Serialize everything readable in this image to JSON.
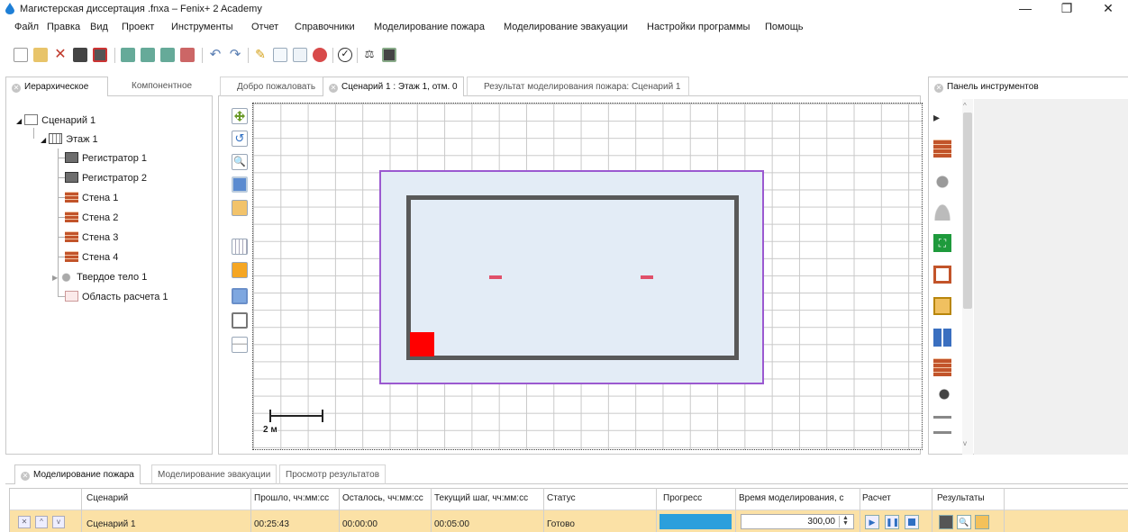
{
  "window": {
    "title": "Магистерская диссертация .fnxa – Fenix+ 2 Academy",
    "minimize": "—",
    "restore": "❐",
    "close": "✕"
  },
  "menu": [
    "Файл",
    "Правка",
    "Вид",
    "Проект",
    "Инструменты",
    "Отчет",
    "Справочники",
    "Моделирование пожара",
    "Моделирование эвакуации",
    "Настройки программы",
    "Помощь"
  ],
  "left_panel": {
    "tabs": [
      "Иерархическое",
      "Компонентное"
    ],
    "tree": {
      "scenario": "Сценарий 1",
      "floor": "Этаж 1",
      "items": [
        "Регистратор 1",
        "Регистратор 2",
        "Стена 1",
        "Стена 2",
        "Стена 3",
        "Стена 4",
        "Твердое тело 1",
        "Область расчета 1"
      ]
    }
  },
  "editor": {
    "tabs": [
      "Добро пожаловать",
      "Сценарий 1 : Этаж 1, отм. 0",
      "Результат моделирования пожара: Сценарий 1"
    ],
    "scale_label": "2 м"
  },
  "tools_panel": {
    "title": "Панель инструментов"
  },
  "bottom": {
    "tabs": [
      "Моделирование пожара",
      "Моделирование эвакуации",
      "Просмотр результатов"
    ],
    "columns": [
      "Сценарий",
      "Прошло, чч:мм:сс",
      "Осталось, чч:мм:сс",
      "Текущий шаг, чч:мм:сс",
      "Статус",
      "Прогресс",
      "Время моделирования, с",
      "Расчет",
      "Результаты"
    ],
    "row": {
      "scenario": "Сценарий 1",
      "elapsed": "00:25:43",
      "remaining": "00:00:00",
      "step": "00:05:00",
      "status": "Готово",
      "progress": 1.0,
      "sim_time": "300,00"
    }
  },
  "colors": {
    "room_fill": "#e3ecf6",
    "calc_area_border": "#9b59d0",
    "wall": "#595959",
    "fire_source": "#ff0000",
    "registrator": "#e0506a",
    "progress": "#2b9fdc",
    "row_highlight": "#fbe1a6"
  }
}
